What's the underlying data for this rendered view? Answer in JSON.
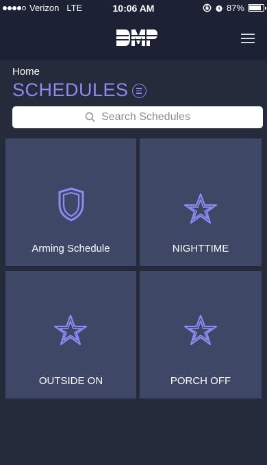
{
  "status_bar": {
    "carrier": "Verizon",
    "network": "LTE",
    "time": "10:06 AM",
    "battery": "87%",
    "battery_level": 0.87
  },
  "header": {
    "logo_icon": "dmp-logo",
    "menu_icon": "hamburger-menu-icon"
  },
  "breadcrumb": "Home",
  "title": "SCHEDULES",
  "search": {
    "placeholder": "Search Schedules"
  },
  "tiles": [
    {
      "label": "Arming Schedule",
      "icon": "shield-icon"
    },
    {
      "label": "NIGHTTIME",
      "icon": "star-icon"
    },
    {
      "label": "OUTSIDE ON",
      "icon": "star-icon"
    },
    {
      "label": "PORCH OFF",
      "icon": "star-icon"
    }
  ],
  "colors": {
    "background": "#262b3c",
    "header": "#1c2233",
    "tile": "#3f4766",
    "accent": "#8b8cf2"
  }
}
